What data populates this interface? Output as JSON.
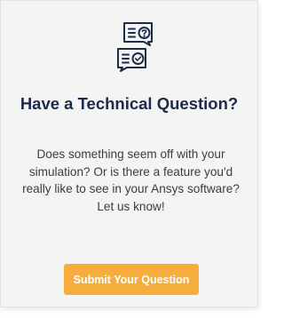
{
  "card": {
    "icon": "chat-question-check-icon",
    "title": "Have a Technical Question?",
    "description": "Does something seem off with your simulation? Or is there a feature you'd really like to see in your Ansys software? Let us know!",
    "button_label": "Submit Your Question"
  },
  "colors": {
    "card_background": "#f4f4f4",
    "title": "#1c2b4a",
    "text": "#3c3c3c",
    "button": "#f6ad3b",
    "button_text": "#ffffff",
    "icon_stroke": "#1c2b4a"
  }
}
